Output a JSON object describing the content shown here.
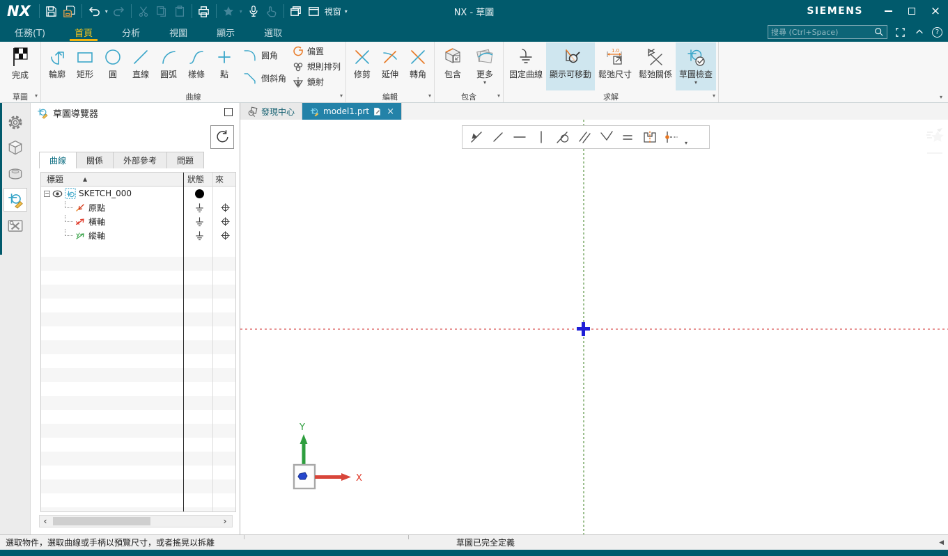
{
  "colors": {
    "titlebar_teal": "#015a6c",
    "accent_yellow": "#efb310",
    "icon_teal": "#3aa6c9",
    "icon_orange": "#e87722",
    "active_doc_tab_blue": "#2382a8",
    "highlight_blue": "#cfe6ef",
    "datum_green": "#9cbf8e",
    "datum_red": "#e89595",
    "origin_cross_blue": "#1f1fd6"
  },
  "icons": {
    "dropdown": "▾",
    "sort_asc": "▲",
    "close": "×",
    "left": "‹",
    "right": "›",
    "status_back": "◀",
    "help": "?",
    "expander": "−"
  },
  "titlebar": {
    "logo": "NX",
    "title": "NX - 草圖",
    "brand": "SIEMENS",
    "window_label": "視窗"
  },
  "menu": {
    "tabs": [
      {
        "label": "任務(T)"
      },
      {
        "label": "首頁"
      },
      {
        "label": "分析"
      },
      {
        "label": "視圖"
      },
      {
        "label": "顯示"
      },
      {
        "label": "選取"
      }
    ],
    "search_placeholder": "搜尋 (Ctrl+Space)"
  },
  "ribbon": {
    "finish": {
      "button": "完成",
      "group": "草圖"
    },
    "curve": {
      "group": "曲線",
      "profile": "輪廓",
      "rect": "矩形",
      "circle": "圓",
      "line": "直線",
      "arc": "圓弧",
      "spline": "樣條",
      "point": "點",
      "fillet": "圓角",
      "chamfer": "倒斜角",
      "offset": "偏置",
      "pattern": "規則排列",
      "mirror": "鏡射"
    },
    "edit": {
      "group": "編輯",
      "trim": "修剪",
      "extend": "延伸",
      "corner": "轉角"
    },
    "include": {
      "group": "包含",
      "include": "包含",
      "more": "更多"
    },
    "solve": {
      "group": "求解",
      "fix": "固定曲線",
      "show_movable": "顯示可移動",
      "relax_dim": "鬆弛尺寸",
      "relax_rel": "鬆弛關係",
      "check": "草圖檢查"
    }
  },
  "navigator": {
    "title": "草圖導覽器",
    "tabs": [
      {
        "label": "曲線"
      },
      {
        "label": "關係"
      },
      {
        "label": "外部參考"
      },
      {
        "label": "問題"
      }
    ],
    "columns": {
      "title": "標題",
      "status": "狀態",
      "source": "來"
    },
    "rows": [
      {
        "label": "SKETCH_000"
      },
      {
        "label": "原點"
      },
      {
        "label": "橫軸"
      },
      {
        "label": "縱軸"
      }
    ]
  },
  "doc_tabs": [
    {
      "label": "發現中心"
    },
    {
      "label": "model1.prt"
    }
  ],
  "triad": {
    "x": "X",
    "y": "Y"
  },
  "statusbar": {
    "left": "選取物件，選取曲線或手柄以預覽尺寸，或者搖晃以拆離",
    "center": "草圖已完全定義"
  }
}
